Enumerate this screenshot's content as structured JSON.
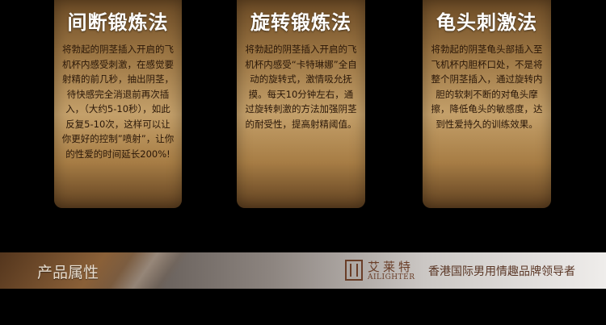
{
  "cards": [
    {
      "title": "间断锻炼法",
      "body": "将勃起的阴茎插入开启的飞机杯内感受刺激，在感觉要射精的前几秒，抽出阴茎，待快感完全消退前再次插入，（大约5-10秒），如此反复5-10次，这样可以让你更好的控制”喷射”，让你的性爱的时间延长200%!"
    },
    {
      "title": "旋转锻炼法",
      "body": "将勃起的阴茎插入开启的飞机杯内感受“卡特琳娜”全自动的旋转式，激情吸允抚摸。每天10分钟左右，通过旋转刺激的方法加强阴茎的耐受性，提高射精阈值。"
    },
    {
      "title": "龟头刺激法",
      "body": "将勃起的阴茎龟头部插入至飞机杯内胆杯口处，不是将整个阴茎插入，通过旋转内胆的软刺不断的对龟头摩擦，降低龟头的敏感度，达到性爱持久的训练效果。"
    }
  ],
  "banner": {
    "label": "产品属性",
    "logo_cn": "艾莱特",
    "logo_en": "AILIGHTER",
    "slogan": "香港国际男用情趣品牌领导者"
  },
  "colors": {
    "card_gold": "#c4a06a",
    "card_text": "#2a1708",
    "logo_brown": "#6a3e28"
  }
}
